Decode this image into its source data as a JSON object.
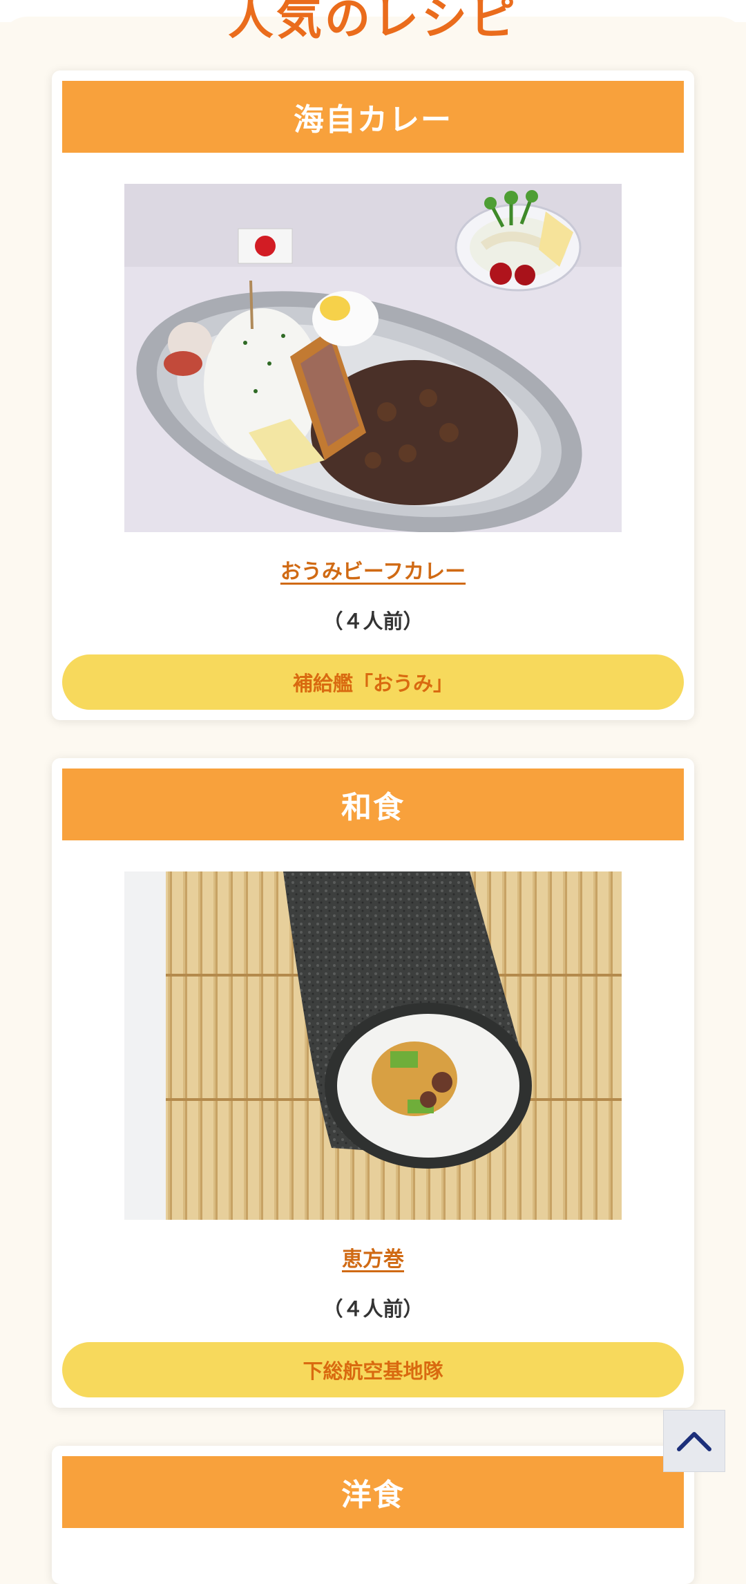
{
  "page": {
    "heading": "人気のレシピ"
  },
  "cards": [
    {
      "category": "海自カレー",
      "recipe_title": "おうみビーフカレー",
      "servings": "（４人前）",
      "unit": "補給艦「おうみ」"
    },
    {
      "category": "和食",
      "recipe_title": "恵方巻",
      "servings": "（４人前）",
      "unit": "下総航空基地隊"
    },
    {
      "category": "洋食"
    }
  ],
  "scroll_top_button": {
    "icon": "chevron-up-icon"
  },
  "colors": {
    "accent_orange": "#f8a13c",
    "heading_orange": "#ea6c1c",
    "link_orange": "#d06a14",
    "pill_yellow": "#f7d95c",
    "page_background": "#fdf9f1"
  }
}
